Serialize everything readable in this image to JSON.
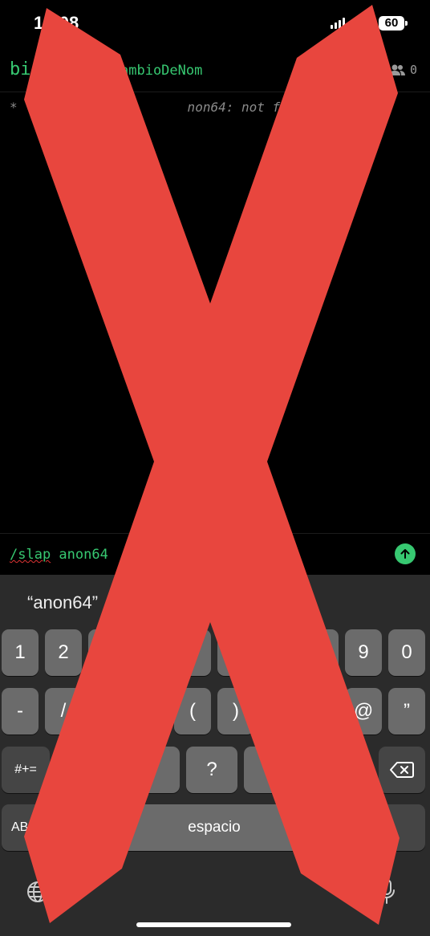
{
  "status_bar": {
    "time": "12:08",
    "battery": "60"
  },
  "header": {
    "channel": "bi",
    "topic": "ambioDeNom",
    "user_count": "0"
  },
  "log": {
    "line": "*                      non64: not found *"
  },
  "input": {
    "command": "/slap",
    "argument": " anon64"
  },
  "keyboard": {
    "suggestion": "“anon64”",
    "row1": [
      "1",
      "2",
      "",
      "",
      "",
      "",
      "",
      "9",
      "0"
    ],
    "row2": [
      "-",
      "/",
      "",
      "",
      "(",
      ")",
      "",
      "@",
      "”"
    ],
    "row3_left": "#+=",
    "row3_middle": "?",
    "abc_label": "AB",
    "space_label": "espacio"
  },
  "overlay": {
    "color": "#e8463e"
  }
}
